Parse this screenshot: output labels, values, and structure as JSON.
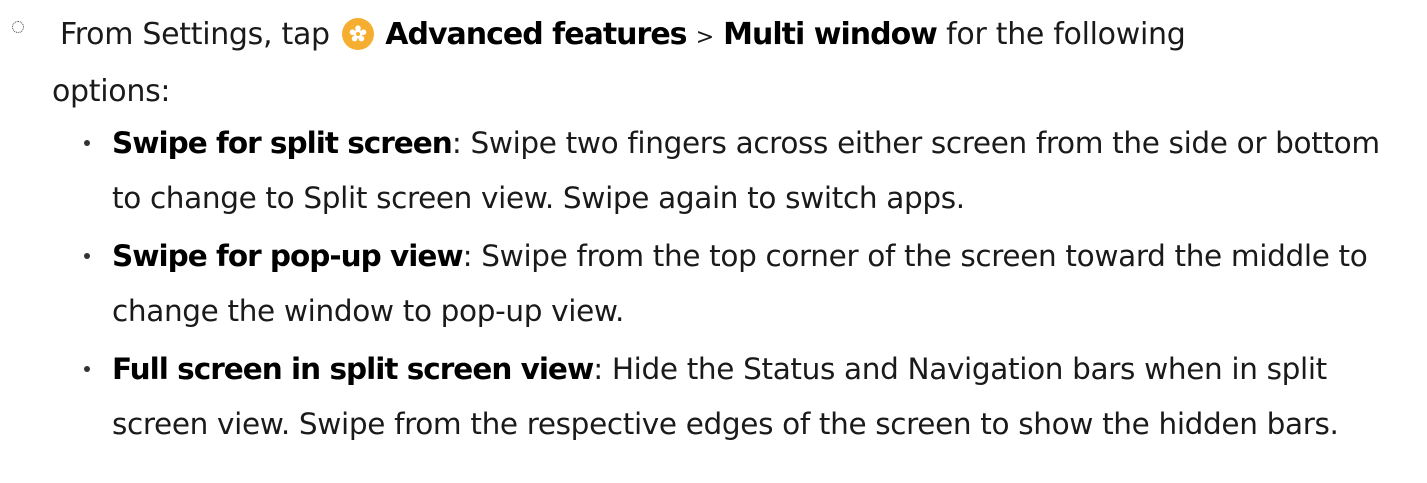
{
  "step": {
    "prefix": "From Settings, tap",
    "icon": "settings-gear-icon",
    "icon_color": "#f5ae2f",
    "path_item_1": "Advanced features",
    "separator": ">",
    "path_item_2": "Multi window",
    "suffix": "for the following options:"
  },
  "options": [
    {
      "name": "Swipe for split screen",
      "colon": ":",
      "description": "Swipe two fingers across either screen from the side or bottom to change to Split screen view. Swipe again to switch apps."
    },
    {
      "name": "Swipe for pop-up view",
      "colon": ":",
      "description": "Swipe from the top corner of the screen toward the middle to change the window to pop-up view."
    },
    {
      "name": "Full screen in split screen view",
      "colon": ":",
      "description": "Hide the Status and Navigation bars when in split screen view. Swipe from the respective edges of the screen to show the hidden bars."
    }
  ]
}
